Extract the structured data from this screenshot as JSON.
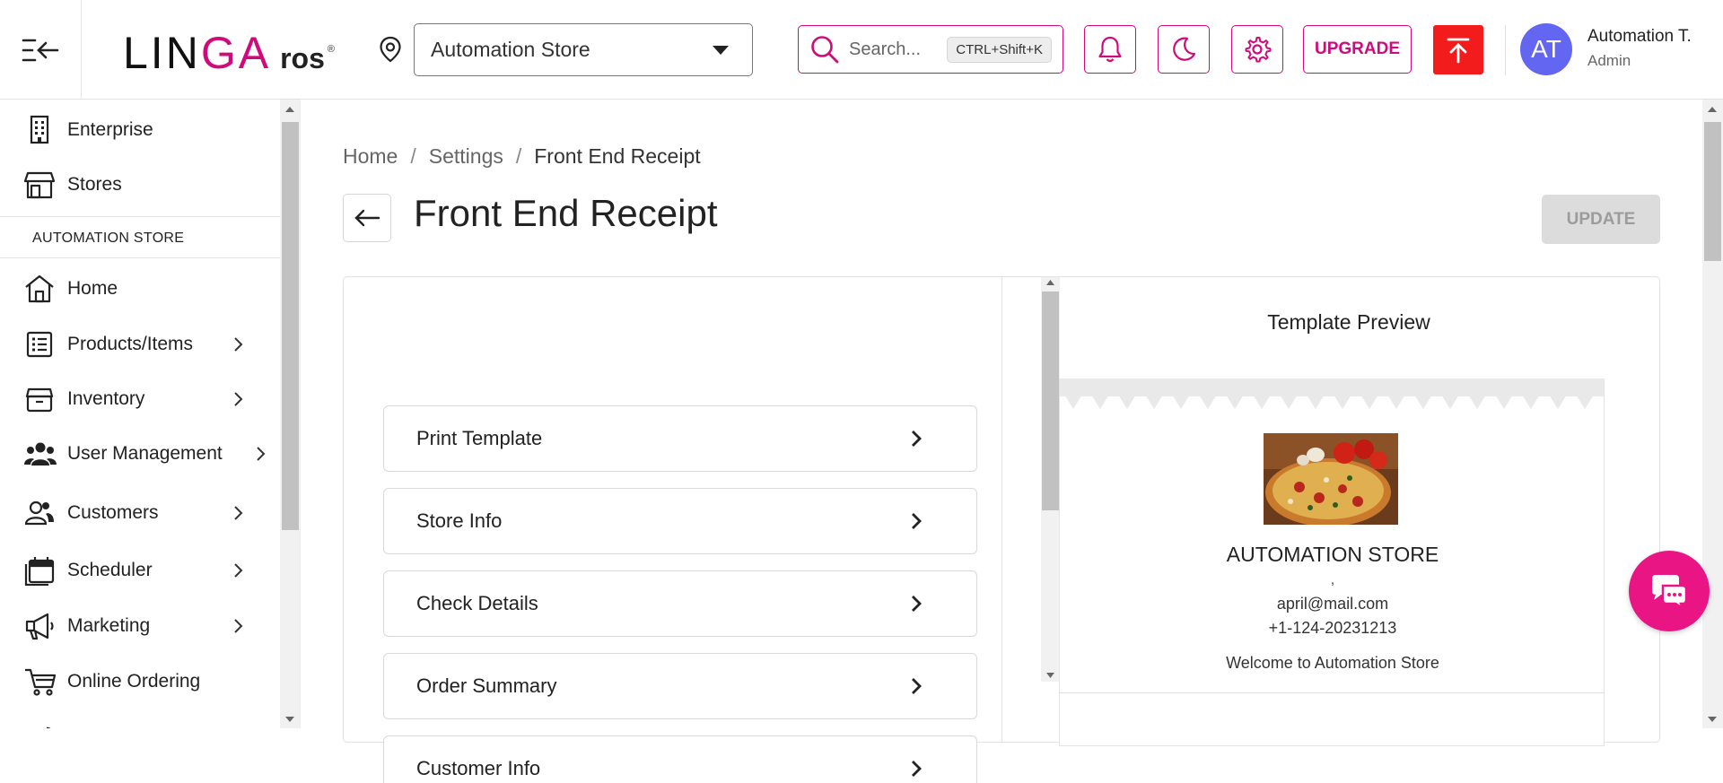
{
  "colors": {
    "brand": "#d10a7c",
    "danger": "#f21c1c",
    "avatar": "#6366f1",
    "chat": "#ea1584"
  },
  "header": {
    "logo": {
      "main_prefix": "LIN",
      "main_accent": "GA",
      "sub": "ros",
      "reg": "®"
    },
    "store_select": {
      "value": "Automation Store"
    },
    "search": {
      "placeholder": "Search...",
      "shortcut": "CTRL+Shift+K"
    },
    "upgrade_label": "UPGRADE",
    "user": {
      "initials": "AT",
      "name": "Automation T.",
      "role": "Admin"
    }
  },
  "sidebar": {
    "top_items": [
      {
        "label": "Enterprise",
        "icon": "building-icon"
      },
      {
        "label": "Stores",
        "icon": "store-icon"
      }
    ],
    "section_label": "AUTOMATION STORE",
    "items": [
      {
        "label": "Home",
        "icon": "home-icon",
        "has_children": false
      },
      {
        "label": "Products/Items",
        "icon": "list-icon",
        "has_children": true
      },
      {
        "label": "Inventory",
        "icon": "box-icon",
        "has_children": true
      },
      {
        "label": "User Management",
        "icon": "users-icon",
        "has_children": true
      },
      {
        "label": "Customers",
        "icon": "customers-icon",
        "has_children": true
      },
      {
        "label": "Scheduler",
        "icon": "calendar-icon",
        "has_children": true
      },
      {
        "label": "Marketing",
        "icon": "megaphone-icon",
        "has_children": true
      },
      {
        "label": "Online Ordering",
        "icon": "cart-icon",
        "has_children": false
      }
    ]
  },
  "breadcrumb": {
    "items": [
      "Home",
      "Settings",
      "Front End Receipt"
    ]
  },
  "page": {
    "title": "Front End Receipt",
    "update_label": "UPDATE"
  },
  "sections": [
    "Print Template",
    "Store Info",
    "Check Details",
    "Order Summary",
    "Customer Info"
  ],
  "preview": {
    "title": "Template Preview",
    "store_name": "AUTOMATION STORE",
    "address": ",",
    "email": "april@mail.com",
    "phone": "+1-124-20231213",
    "welcome": "Welcome to Automation Store"
  }
}
